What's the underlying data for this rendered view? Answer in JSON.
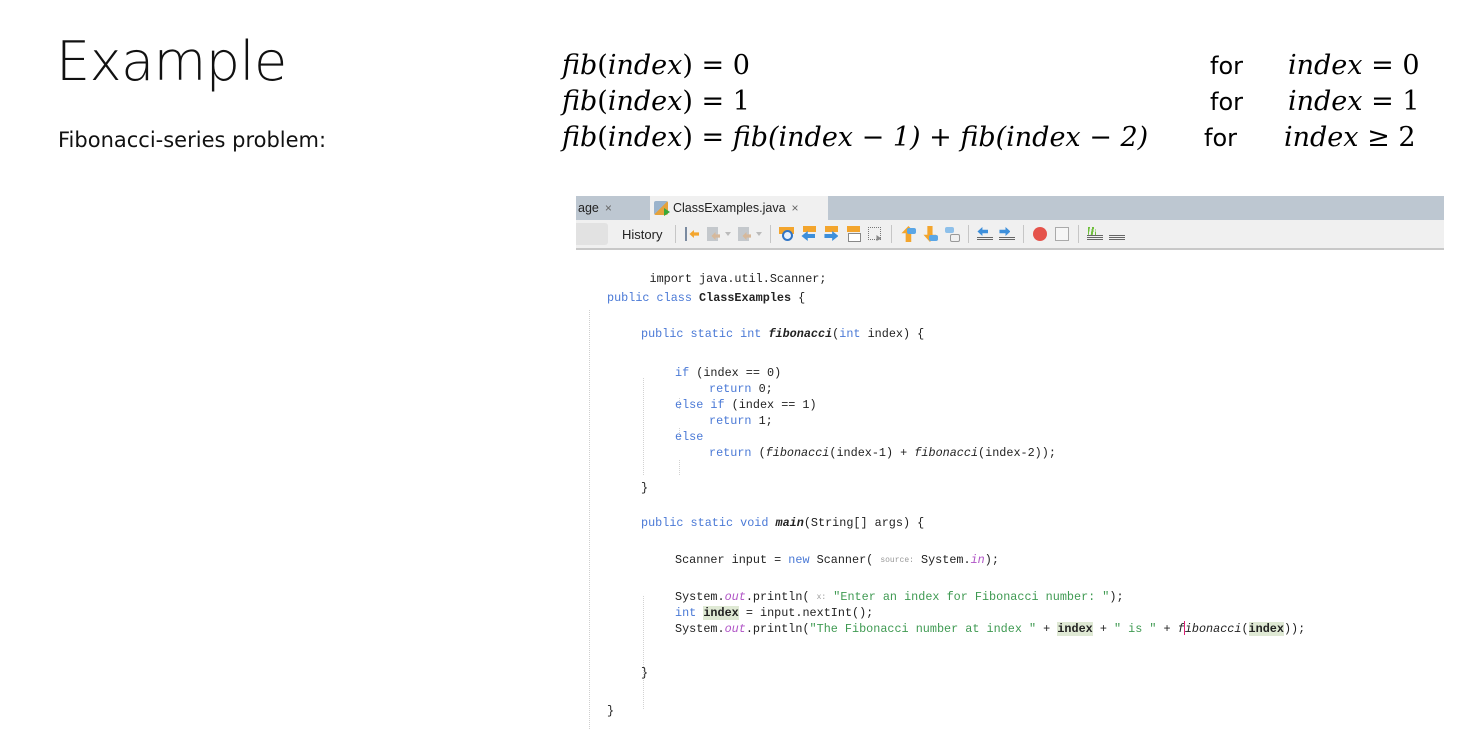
{
  "slide": {
    "title": "Example",
    "subtitle": "Fibonacci-series problem:"
  },
  "formulas": [
    {
      "lhs_func": "fib",
      "lhs_arg": "index",
      "rhs": "0",
      "for_label": "for",
      "cond_var": "index",
      "cond_op": "=",
      "cond_val": "0"
    },
    {
      "lhs_func": "fib",
      "lhs_arg": "index",
      "rhs": "1",
      "for_label": "for",
      "cond_var": "index",
      "cond_op": "=",
      "cond_val": "1"
    },
    {
      "lhs_func": "fib",
      "lhs_arg": "index",
      "rhs": "fib(index − 1) + fib(index − 2)",
      "for_label": "for",
      "cond_var": "index",
      "cond_op": "≥",
      "cond_val": "2"
    }
  ],
  "ide": {
    "tabs": [
      {
        "label": "age",
        "close": "×",
        "active": false
      },
      {
        "label": "ClassExamples.java",
        "close": "×",
        "active": true
      }
    ],
    "toolbar": {
      "history_label": "History",
      "icons": [
        "last-edit-icon",
        "back-icon",
        "forward-icon",
        "find-selection-icon",
        "find-previous-icon",
        "find-next-icon",
        "select-next-icon",
        "rectangular-selection-icon",
        "previous-bookmark-icon",
        "next-bookmark-icon",
        "toggle-bookmark-icon",
        "shift-left-icon",
        "shift-right-icon",
        "record-macro-icon",
        "stop-macro-icon",
        "comment-icon",
        "uncomment-icon"
      ]
    },
    "code": {
      "l1": "import java.util.Scanner;",
      "l2_kw": "public class ",
      "l2_name": "ClassExamples",
      "l2_end": " {",
      "l3_kw": "public static int ",
      "l3_name": "fibonacci",
      "l3_p1": "(",
      "l3_kw2": "int",
      "l3_end": " index) {",
      "l4_kw": "if",
      "l4_end": " (index == 0)",
      "l5_kw": "return",
      "l5_end": " 0;",
      "l6_kw": "else if",
      "l6_end": " (index == 1)",
      "l7_kw": "return",
      "l7_end": " 1;",
      "l8_kw": "else",
      "l9_kw": "return",
      "l9_a": " (",
      "l9_f1": "fibonacci",
      "l9_b": "(index-1) + ",
      "l9_f2": "fibonacci",
      "l9_c": "(index-2));",
      "l10": "}",
      "l11_kw": "public static void ",
      "l11_name": "main",
      "l11_end": "(String[] args) {",
      "l12_a": "Scanner input = ",
      "l12_kw": "new",
      "l12_b": " Scanner( ",
      "l12_hint": "source:",
      "l12_c": " System.",
      "l12_fld": "in",
      "l12_d": ");",
      "l13_a": "System.",
      "l13_fld": "out",
      "l13_b": ".println( ",
      "l13_hint": "x:",
      "l13_str": " \"Enter an index for Fibonacci number: \"",
      "l13_c": ");",
      "l14_kw": "int",
      "l14_sp": " ",
      "l14_var": "index",
      "l14_end": " = input.nextInt();",
      "l15_a": "System.",
      "l15_fld": "out",
      "l15_b": ".println(",
      "l15_s1": "\"The Fibonacci number at index \"",
      "l15_c": " + ",
      "l15_v1": "index",
      "l15_d": " + ",
      "l15_s2": "\" is \"",
      "l15_e": " + ",
      "l15_f0": "f",
      "l15_f": "ibonacci",
      "l15_g": "(",
      "l15_v2": "index",
      "l15_h": "));",
      "l16": "}",
      "l17": "}"
    }
  }
}
